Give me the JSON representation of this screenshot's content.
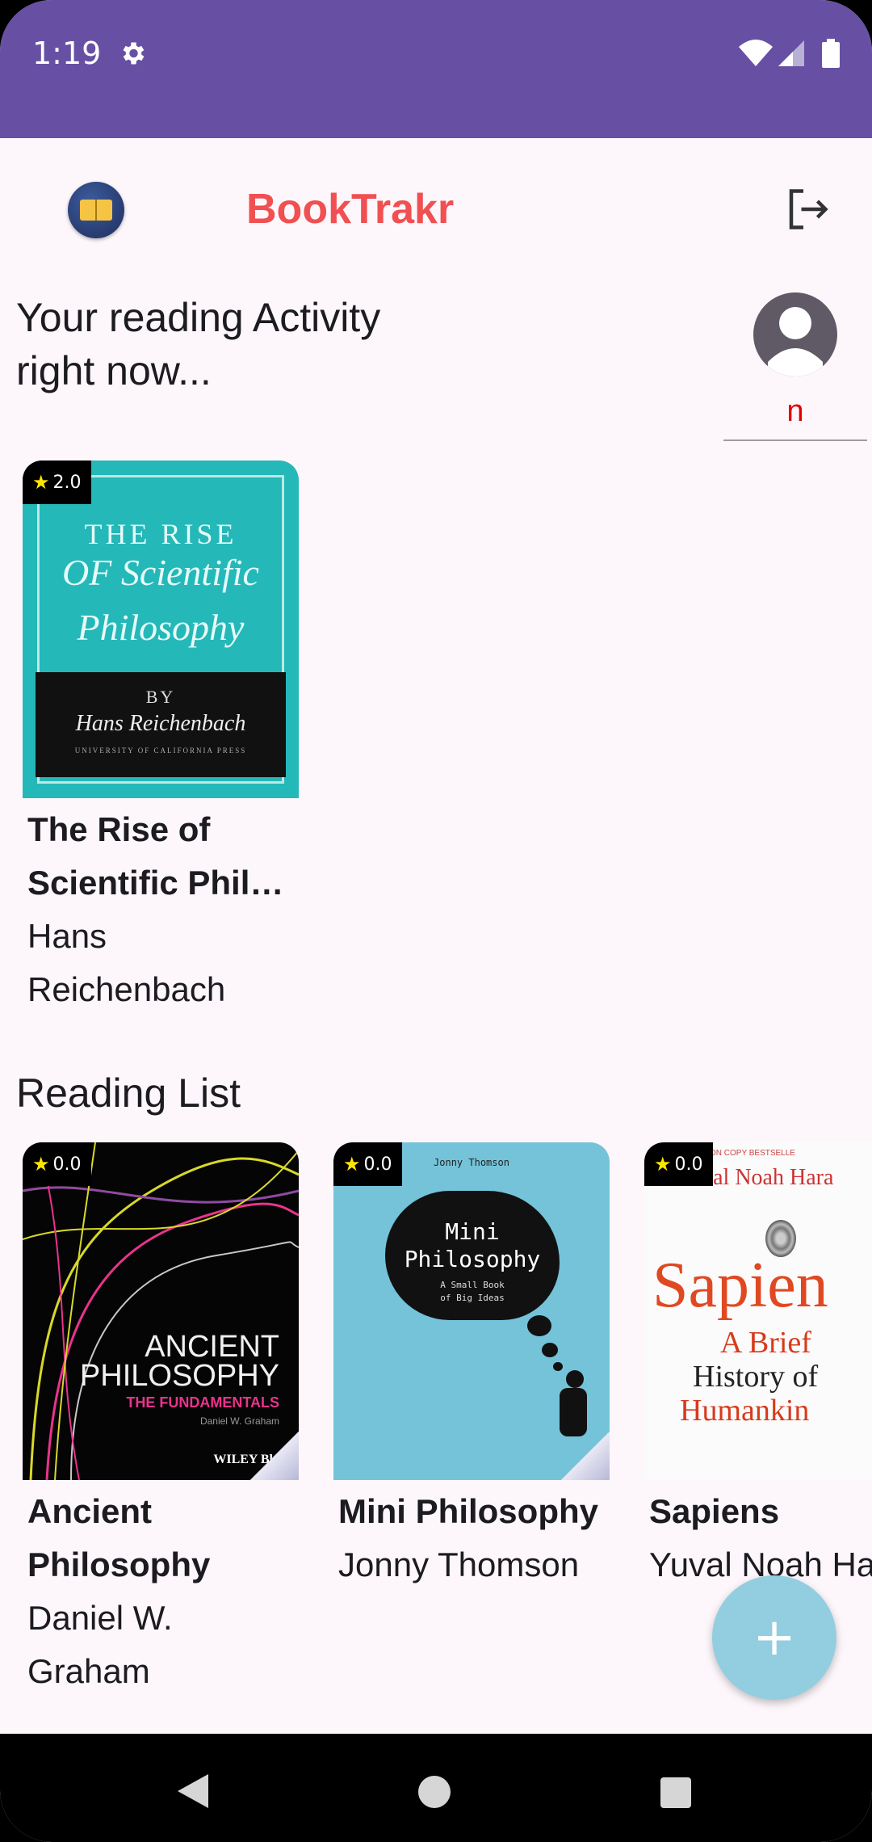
{
  "status_bar": {
    "time": "1:19",
    "icons": [
      "gear-icon",
      "wifi-icon",
      "signal-icon",
      "battery-icon"
    ]
  },
  "app_bar": {
    "title": "BookTrakr",
    "logo_icon": "book-logo-icon",
    "logout_icon": "logout-icon"
  },
  "activity": {
    "title": "Your reading Activity right now...",
    "profile_name": "n"
  },
  "current_books": [
    {
      "rating": "2.0",
      "title": "The Rise of Scientific Phil…",
      "author": "Hans Reichenbach",
      "cover_text": {
        "line1": "THE RISE",
        "line2": "OF Scientific",
        "line3": "Philosophy",
        "by": "BY",
        "author": "Hans Reichenbach",
        "press": "UNIVERSITY OF CALIFORNIA PRESS"
      }
    }
  ],
  "reading_list": {
    "title": "Reading List",
    "books": [
      {
        "rating": "0.0",
        "title": "Ancient Philosophy",
        "author": "Daniel W. Graham",
        "cover_text": {
          "line1": "ANCIENT",
          "line2": "PHILOSOPHY",
          "line3": "THE FUNDAMENTALS",
          "line4": "Daniel W. Graham",
          "publisher": "WILEY Bla"
        }
      },
      {
        "rating": "0.0",
        "title": "Mini Philosophy",
        "author": "Jonny Thomson",
        "cover_text": {
          "top": "Jonny Thomson",
          "line1": "Mini",
          "line2": "Philosophy",
          "line3": "A Small Book",
          "line4": "of Big Ideas"
        }
      },
      {
        "rating": "0.0",
        "title": "Sapiens",
        "author": "Yuval Noah Hara",
        "cover_text": {
          "top": "MILLION COPY BESTSELLE",
          "author": "Yuval Noah Hara",
          "big": "Sapien",
          "line1": "A Brief",
          "line2": "History of",
          "line3": "Humankin"
        }
      }
    ]
  },
  "fab": {
    "label": "+"
  },
  "colors": {
    "status_bar": "#6750a4",
    "title": "#f05052",
    "profile_name": "#e00000",
    "fab": "#92cee0",
    "background": "#fdf7fc"
  }
}
